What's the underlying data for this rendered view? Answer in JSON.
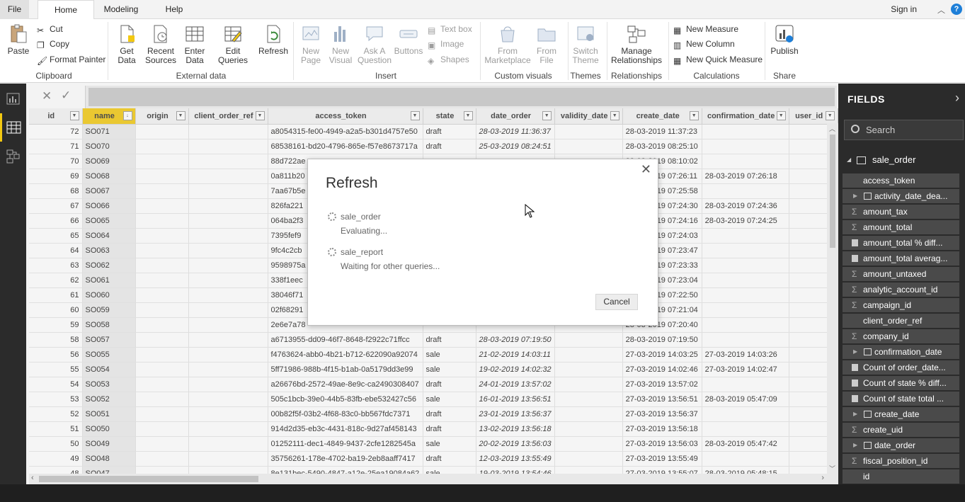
{
  "tabs": [
    "File",
    "Home",
    "Modeling",
    "Help"
  ],
  "active_tab": "Home",
  "sign_in": "Sign in",
  "ribbon": {
    "paste": "Paste",
    "cut": "Cut",
    "copy": "Copy",
    "format_painter": "Format Painter",
    "clipboard": "Clipboard",
    "get_data": "Get\nData",
    "recent_sources": "Recent\nSources",
    "enter_data": "Enter\nData",
    "edit_queries": "Edit\nQueries",
    "refresh": "Refresh",
    "external_data": "External data",
    "new_page": "New\nPage",
    "new_visual": "New\nVisual",
    "ask_a_question": "Ask A\nQuestion",
    "buttons": "Buttons",
    "text_box": "Text box",
    "image": "Image",
    "shapes": "Shapes",
    "insert": "Insert",
    "from_marketplace": "From\nMarketplace",
    "from_file": "From\nFile",
    "custom_visuals": "Custom visuals",
    "switch_theme": "Switch\nTheme",
    "themes": "Themes",
    "manage_relationships": "Manage\nRelationships",
    "relationships": "Relationships",
    "new_measure": "New Measure",
    "new_column": "New Column",
    "new_quick_measure": "New Quick Measure",
    "calculations": "Calculations",
    "publish": "Publish",
    "share": "Share"
  },
  "grid": {
    "columns": [
      "id",
      "name",
      "origin",
      "client_order_ref",
      "access_token",
      "state",
      "date_order",
      "validity_date",
      "create_date",
      "confirmation_date",
      "user_id"
    ],
    "rows": [
      [
        "72",
        "SO071",
        "",
        "",
        "a8054315-fe00-4949-a2a5-b301d4757e50",
        "draft",
        "28-03-2019 11:36:37",
        "",
        "28-03-2019 11:37:23",
        ""
      ],
      [
        "71",
        "SO070",
        "",
        "",
        "68538161-bd20-4796-865e-f57e8673717a",
        "draft",
        "25-03-2019 08:24:51",
        "",
        "28-03-2019 08:25:10",
        ""
      ],
      [
        "70",
        "SO069",
        "",
        "",
        "88d722ae",
        "",
        "",
        "",
        "28-03-2019 08:10:02",
        ""
      ],
      [
        "69",
        "SO068",
        "",
        "",
        "0a811b20",
        "",
        "",
        "",
        "28-03-2019 07:26:11",
        "28-03-2019 07:26:18"
      ],
      [
        "68",
        "SO067",
        "",
        "",
        "7aa67b5e",
        "",
        "",
        "",
        "28-03-2019 07:25:58",
        ""
      ],
      [
        "67",
        "SO066",
        "",
        "",
        "826fa221",
        "",
        "",
        "",
        "28-03-2019 07:24:30",
        "28-03-2019 07:24:36"
      ],
      [
        "66",
        "SO065",
        "",
        "",
        "064ba2f3",
        "",
        "",
        "",
        "28-03-2019 07:24:16",
        "28-03-2019 07:24:25"
      ],
      [
        "65",
        "SO064",
        "",
        "",
        "7395fef9",
        "",
        "",
        "",
        "28-03-2019 07:24:03",
        ""
      ],
      [
        "64",
        "SO063",
        "",
        "",
        "9fc4c2cb",
        "",
        "",
        "",
        "28-03-2019 07:23:47",
        ""
      ],
      [
        "63",
        "SO062",
        "",
        "",
        "9598975a",
        "",
        "",
        "",
        "28-03-2019 07:23:33",
        ""
      ],
      [
        "62",
        "SO061",
        "",
        "",
        "338f1eec",
        "",
        "",
        "",
        "28-03-2019 07:23:04",
        ""
      ],
      [
        "61",
        "SO060",
        "",
        "",
        "38046f71",
        "",
        "",
        "",
        "28-03-2019 07:22:50",
        ""
      ],
      [
        "60",
        "SO059",
        "",
        "",
        "02f68291",
        "",
        "",
        "",
        "28-03-2019 07:21:04",
        ""
      ],
      [
        "59",
        "SO058",
        "",
        "",
        "2e6e7a78",
        "",
        "",
        "",
        "28-03-2019 07:20:40",
        ""
      ],
      [
        "58",
        "SO057",
        "",
        "",
        "a6713955-dd09-46f7-8648-f2922c71ffcc",
        "draft",
        "28-03-2019 07:19:50",
        "",
        "28-03-2019 07:19:50",
        ""
      ],
      [
        "56",
        "SO055",
        "",
        "",
        "f4763624-abb0-4b21-b712-622090a92074",
        "sale",
        "21-02-2019 14:03:11",
        "",
        "27-03-2019 14:03:25",
        "27-03-2019 14:03:26"
      ],
      [
        "55",
        "SO054",
        "",
        "",
        "5ff71986-988b-4f15-b1ab-0a5179dd3e99",
        "sale",
        "19-02-2019 14:02:32",
        "",
        "27-03-2019 14:02:46",
        "27-03-2019 14:02:47"
      ],
      [
        "54",
        "SO053",
        "",
        "",
        "a26676bd-2572-49ae-8e9c-ca2490308407",
        "draft",
        "24-01-2019 13:57:02",
        "",
        "27-03-2019 13:57:02",
        ""
      ],
      [
        "53",
        "SO052",
        "",
        "",
        "505c1bcb-39e0-44b5-83fb-ebe532427c56",
        "sale",
        "16-01-2019 13:56:51",
        "",
        "27-03-2019 13:56:51",
        "28-03-2019 05:47:09"
      ],
      [
        "52",
        "SO051",
        "",
        "",
        "00b82f5f-03b2-4f68-83c0-bb567fdc7371",
        "draft",
        "23-01-2019 13:56:37",
        "",
        "27-03-2019 13:56:37",
        ""
      ],
      [
        "51",
        "SO050",
        "",
        "",
        "914d2d35-eb3c-4431-818c-9d27af458143",
        "draft",
        "13-02-2019 13:56:18",
        "",
        "27-03-2019 13:56:18",
        ""
      ],
      [
        "50",
        "SO049",
        "",
        "",
        "01252111-dec1-4849-9437-2cfe1282545a",
        "sale",
        "20-02-2019 13:56:03",
        "",
        "27-03-2019 13:56:03",
        "28-03-2019 05:47:42"
      ],
      [
        "49",
        "SO048",
        "",
        "",
        "35756261-178e-4702-ba19-2eb8aaff7417",
        "draft",
        "12-03-2019 13:55:49",
        "",
        "27-03-2019 13:55:49",
        ""
      ],
      [
        "48",
        "SO047",
        "",
        "",
        "8e131bec-5490-4847-a12e-25ea19084a62",
        "sale",
        "19-03-2019 13:54:46",
        "",
        "27-03-2019 13:55:07",
        "28-03-2019 05:48:15"
      ]
    ]
  },
  "fields": {
    "header": "FIELDS",
    "search_placeholder": "Search",
    "table_name": "sale_order",
    "items": [
      {
        "label": "access_token",
        "kind": "text"
      },
      {
        "label": "activity_date_dea...",
        "kind": "date"
      },
      {
        "label": "amount_tax",
        "kind": "sum"
      },
      {
        "label": "amount_total",
        "kind": "sum"
      },
      {
        "label": "amount_total % diff...",
        "kind": "calc"
      },
      {
        "label": "amount_total averag...",
        "kind": "calc"
      },
      {
        "label": "amount_untaxed",
        "kind": "sum"
      },
      {
        "label": "analytic_account_id",
        "kind": "sum"
      },
      {
        "label": "campaign_id",
        "kind": "sum"
      },
      {
        "label": "client_order_ref",
        "kind": "text"
      },
      {
        "label": "company_id",
        "kind": "sum"
      },
      {
        "label": "confirmation_date",
        "kind": "date"
      },
      {
        "label": "Count of order_date...",
        "kind": "calc"
      },
      {
        "label": "Count of state % diff...",
        "kind": "calc"
      },
      {
        "label": "Count of state total ...",
        "kind": "calc"
      },
      {
        "label": "create_date",
        "kind": "date"
      },
      {
        "label": "create_uid",
        "kind": "sum"
      },
      {
        "label": "date_order",
        "kind": "date"
      },
      {
        "label": "fiscal_position_id",
        "kind": "sum"
      },
      {
        "label": "id",
        "kind": "text"
      }
    ]
  },
  "dialog": {
    "title": "Refresh",
    "queries": [
      {
        "name": "sale_order",
        "status": "Evaluating..."
      },
      {
        "name": "sale_report",
        "status": "Waiting for other queries..."
      }
    ],
    "cancel": "Cancel"
  }
}
